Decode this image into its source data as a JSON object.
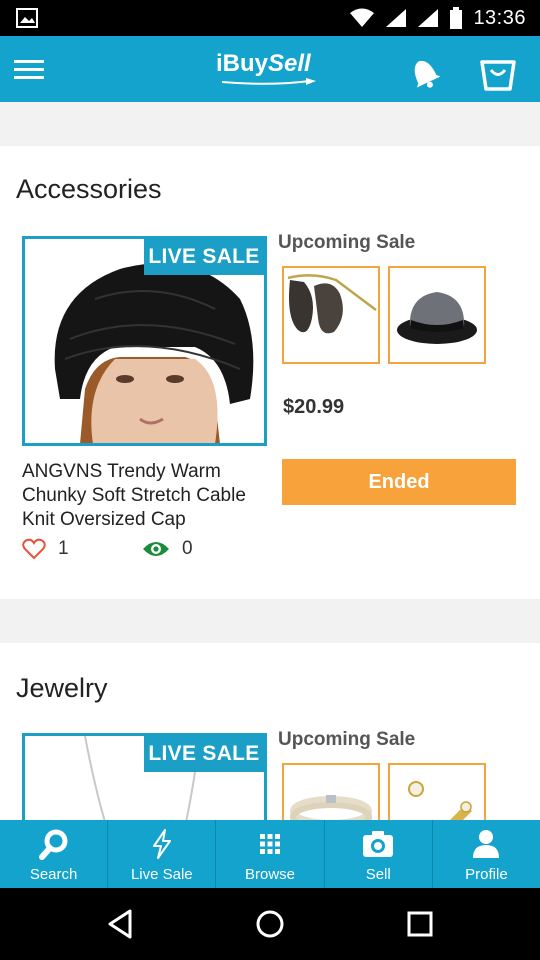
{
  "status_bar": {
    "time": "13:36"
  },
  "app_bar": {
    "logo_part1": "iBuy",
    "logo_part2": "Sell"
  },
  "sections": [
    {
      "title": "Accessories",
      "badge": "LIVE SALE",
      "upcoming_label": "Upcoming Sale",
      "price": "$20.99",
      "status_button": "Ended",
      "product_name": "ANGVNS Trendy Warm Chunky Soft Stretch Cable Knit Oversized Cap",
      "likes": "1",
      "views": "0"
    },
    {
      "title": "Jewelry",
      "badge": "LIVE SALE",
      "upcoming_label": "Upcoming Sale"
    }
  ],
  "bottom_nav": [
    {
      "label": "Search",
      "icon": "search-icon"
    },
    {
      "label": "Live Sale",
      "icon": "lightning-icon"
    },
    {
      "label": "Browse",
      "icon": "grid-icon"
    },
    {
      "label": "Sell",
      "icon": "camera-icon"
    },
    {
      "label": "Profile",
      "icon": "person-icon"
    }
  ],
  "colors": {
    "primary": "#13a3cd",
    "accent": "#f7a23b",
    "frame": "#1b9fc6",
    "thumb_border": "#f5a33a"
  }
}
